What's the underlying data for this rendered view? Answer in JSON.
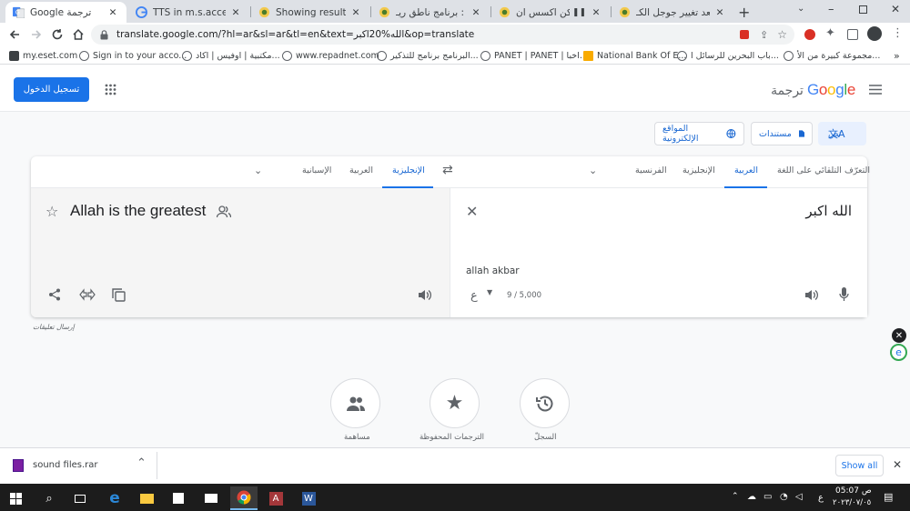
{
  "browser": {
    "tabs": [
      {
        "title": "Google ترجمة",
        "active": true
      },
      {
        "title": "TTS in m.s.access - قد",
        "active": false
      },
      {
        "title": "Showing results for 'sp",
        "active": false
      },
      {
        "title": "هدية : برنامج ناطق ريـ",
        "active": false
      },
      {
        "title": "هل يمكن اكسس ان",
        "active": false
      },
      {
        "title": "ماذا بعد تغيير جوجل الكـ",
        "active": false
      }
    ],
    "url": "translate.google.com/?hl=ar&sl=ar&tl=en&text=الله%20اكبر&op=translate",
    "bookmarks": [
      "my.eset.com",
      "Sign in to your acco...",
      "مكتبية | اوفيس | اكاد...",
      "www.repadnet.com",
      "البرنامج برنامج للتذكير...",
      "PANET | PANET | اخبا...",
      "National Bank Of E...",
      "باب البحرين للرسائل ا...",
      "مجموعة كبيرة من الأ..."
    ]
  },
  "header": {
    "product": "ترجمة",
    "logo": "Google",
    "signin_label": "تسجيل الدخول"
  },
  "modes": {
    "text": "نص",
    "documents": "مستندات",
    "websites": "المواقع الإلكترونية"
  },
  "source_langs": [
    "التعرّف التلقائي على اللغة",
    "العربية",
    "الإنجليزية",
    "الفرنسية"
  ],
  "target_langs": [
    "الإنجليزية",
    "العربية",
    "الإسبانية"
  ],
  "input": {
    "text": "الله اكبر",
    "transliteration": "allah akbar",
    "char_count": "9 / 5,000",
    "ime_label": "ع"
  },
  "output": {
    "text": "Allah is the greatest"
  },
  "feedback_label": "إرسال تعليقات",
  "bottom_actions": [
    {
      "label": "السجلّ",
      "icon": "history-icon"
    },
    {
      "label": "الترجمات المحفوظة",
      "icon": "star-icon"
    },
    {
      "label": "مساهمة",
      "icon": "people-icon"
    }
  ],
  "download": {
    "filename": "sound files.rar",
    "show_all": "Show all"
  },
  "taskbar": {
    "time": "05:07 ص",
    "date": "٢٠٢٣/٠٧/٠٥",
    "lang": "ع"
  }
}
